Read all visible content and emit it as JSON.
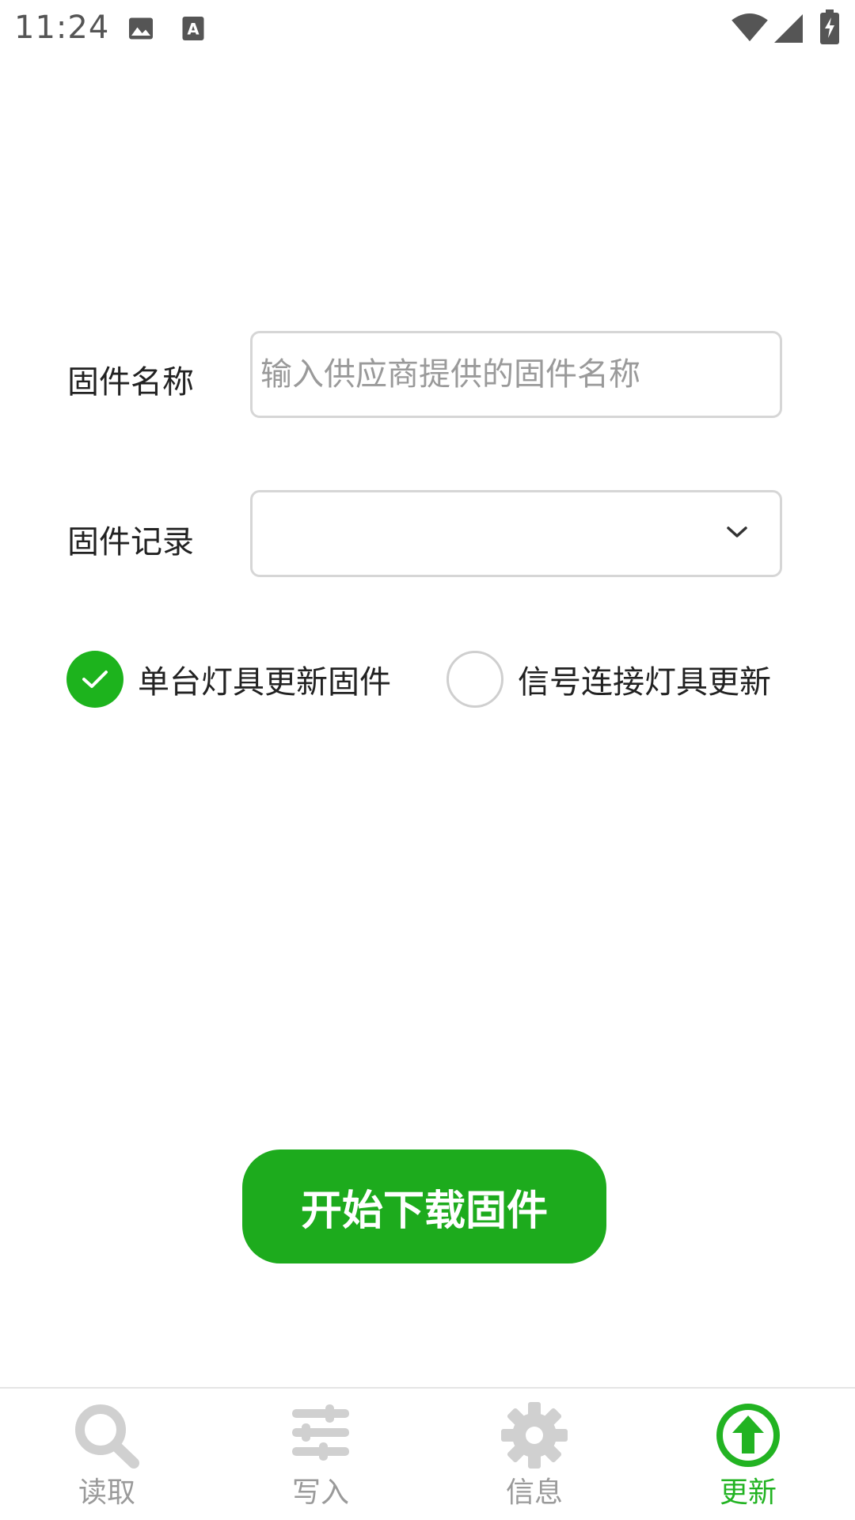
{
  "status_bar": {
    "time": "11:24"
  },
  "form": {
    "firmware_name": {
      "label": "固件名称",
      "placeholder": "输入供应商提供的固件名称",
      "value": ""
    },
    "firmware_record": {
      "label": "固件记录",
      "selected": ""
    },
    "radio_options": [
      {
        "label": "单台灯具更新固件",
        "checked": true
      },
      {
        "label": "信号连接灯具更新",
        "checked": false
      }
    ]
  },
  "actions": {
    "start_download_label": "开始下载固件"
  },
  "bottom_nav": {
    "items": [
      {
        "label": "读取",
        "icon": "search-icon",
        "active": false
      },
      {
        "label": "写入",
        "icon": "sliders-icon",
        "active": false
      },
      {
        "label": "信息",
        "icon": "gear-icon",
        "active": false
      },
      {
        "label": "更新",
        "icon": "upload-arrow-icon",
        "active": true
      }
    ]
  },
  "colors": {
    "accent": "#1dab1d",
    "inactive": "#9a9a9a"
  }
}
